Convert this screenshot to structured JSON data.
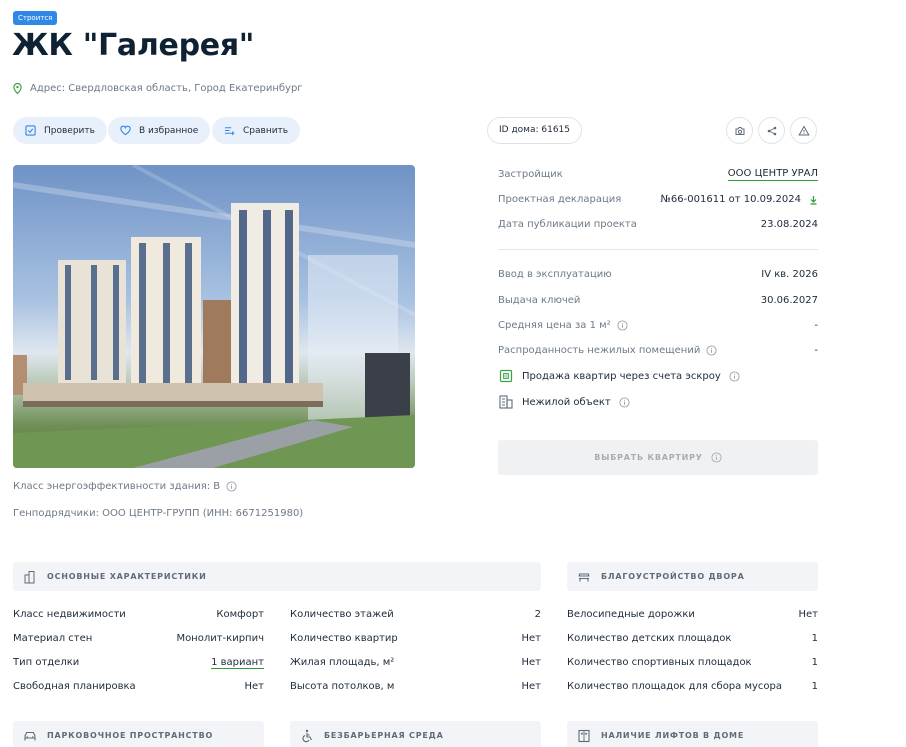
{
  "badge": "Строится",
  "title": "ЖК \"Галерея\"",
  "address": "Адрес: Свердловская область, Город Екатеринбург",
  "actions": {
    "check": "Проверить",
    "favorite": "В избранное",
    "compare": "Сравнить"
  },
  "house_id": "ID дома: 61615",
  "info": {
    "developer_label": "Застройщик",
    "developer_value": "ООО ЦЕНТР УРАЛ",
    "declaration_label": "Проектная декларация",
    "declaration_value": "№66-001611 от 10.09.2024",
    "published_label": "Дата публикации проекта",
    "published_value": "23.08.2024",
    "commissioning_label": "Ввод в эксплуатацию",
    "commissioning_value": "IV кв. 2026",
    "keys_label": "Выдача ключей",
    "keys_value": "30.06.2027",
    "avg_price_label": "Средняя цена за 1 м²",
    "avg_price_value": "-",
    "sold_nonres_label": "Распроданность нежилых помещений",
    "sold_nonres_value": "-"
  },
  "features": {
    "escrow": "Продажа квартир через счета эскроу",
    "nonresidential": "Нежилой объект"
  },
  "cta": "ВЫБРАТЬ КВАРТИРУ",
  "energy_class": "Класс энергоэффективности здания: В",
  "contractors": "Генподрядчики: ООО ЦЕНТР-ГРУПП (ИНН: 6671251980)",
  "sections": {
    "main": "ОСНОВНЫЕ ХАРАКТЕРИСТИКИ",
    "yard": "БЛАГОУСТРОЙСТВО ДВОРА",
    "parking": "ПАРКОВОЧНОЕ ПРОСТРАНСТВО",
    "barrier_free": "БЕЗБАРЬЕРНАЯ СРЕДА",
    "elevators": "НАЛИЧИЕ ЛИФТОВ В ДОМЕ"
  },
  "main_col1": [
    {
      "k": "Класс недвижимости",
      "v": "Комфорт"
    },
    {
      "k": "Материал стен",
      "v": "Монолит-кирпич"
    },
    {
      "k": "Тип отделки",
      "v": "1 вариант"
    },
    {
      "k": "Свободная планировка",
      "v": "Нет"
    }
  ],
  "main_col2": [
    {
      "k": "Количество этажей",
      "v": "2"
    },
    {
      "k": "Количество квартир",
      "v": "Нет"
    },
    {
      "k": "Жилая площадь, м²",
      "v": "Нет"
    },
    {
      "k": "Высота потолков, м",
      "v": "Нет"
    }
  ],
  "yard_rows": [
    {
      "k": "Велосипедные дорожки",
      "v": "Нет"
    },
    {
      "k": "Количество детских площадок",
      "v": "1"
    },
    {
      "k": "Количество спортивных площадок",
      "v": "1"
    },
    {
      "k": "Количество площадок для сбора мусора",
      "v": "1"
    }
  ],
  "colors": {
    "accent": "#2f87e6",
    "green": "#2a9a3a",
    "pill_bg": "#e8f1fb"
  }
}
